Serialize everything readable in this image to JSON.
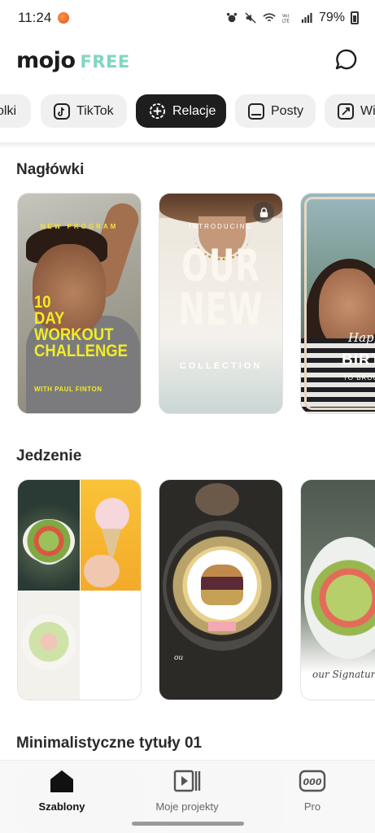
{
  "status_bar": {
    "time": "11:24",
    "battery": "79%"
  },
  "header": {
    "logo": "mojo",
    "plan": "FREE"
  },
  "tabs": [
    {
      "label": "olki",
      "icon": "partial-icon"
    },
    {
      "label": "TikTok",
      "icon": "tiktok-icon"
    },
    {
      "label": "Relacje",
      "icon": "plus-circle-icon",
      "active": true
    },
    {
      "label": "Posty",
      "icon": "square-post-icon"
    },
    {
      "label": "Wi",
      "icon": "expand-icon"
    }
  ],
  "sections": {
    "headlines": {
      "title": "Nagłówki",
      "cards": {
        "workout": {
          "top": "NEW PROGRAM",
          "line1": "10",
          "line2": "DAY",
          "line3": "WORKOUT",
          "line4": "CHALLENGE",
          "with": "WITH PAUL FINTON"
        },
        "our_new": {
          "intro": "INTRODUCING",
          "line1": "OUR",
          "line2": "NEW",
          "collection": "COLLECTION"
        },
        "birthday": {
          "happy": "Happy",
          "birthday": "BIRTHD",
          "to": "TO BROOK WA"
        }
      }
    },
    "food": {
      "title": "Jedzenie",
      "cards": {
        "burger_caption": "ou",
        "signature": "our Signature"
      }
    },
    "minimal": {
      "title": "Minimalistyczne tytuły 01"
    }
  },
  "bottom_nav": [
    {
      "label": "Szablony",
      "icon": "home-icon",
      "active": true
    },
    {
      "label": "Moje projekty",
      "icon": "projects-icon"
    },
    {
      "label": "Pro",
      "icon": "pro-badge-icon"
    }
  ],
  "colors": {
    "accent": "#7fd6c4",
    "active_tab": "#1e1e1e",
    "poster_yellow": "#f2ec25"
  }
}
